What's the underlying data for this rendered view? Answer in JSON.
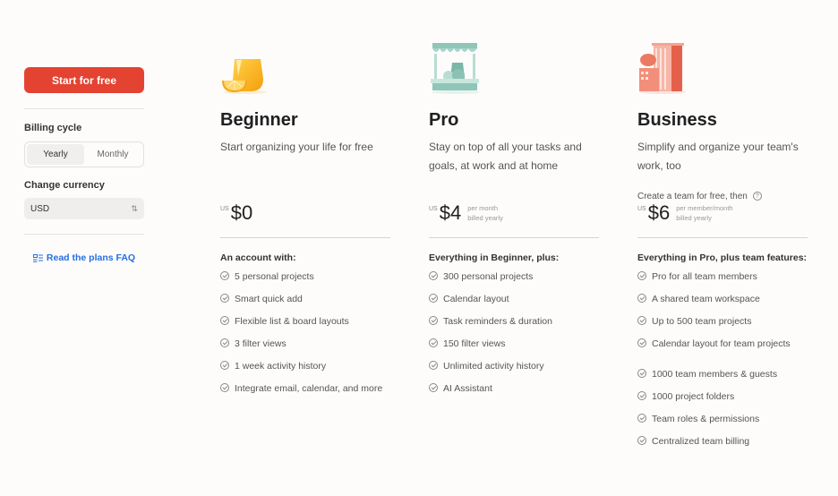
{
  "sidebar": {
    "cta_label": "Start for free",
    "billing_label": "Billing cycle",
    "billing_options": [
      "Yearly",
      "Monthly"
    ],
    "billing_selected": "Yearly",
    "currency_label": "Change currency",
    "currency_value": "USD",
    "faq_icon": "faq-list-icon",
    "faq_label": "Read the plans FAQ"
  },
  "plans": [
    {
      "name": "Beginner",
      "icon": "orange-juice-glass-icon",
      "description": "Start organizing your life for free",
      "currency_prefix": "US",
      "price": "$0",
      "price_note": [
        "",
        ""
      ],
      "features_heading": "An account with:",
      "features": [
        "5 personal projects",
        "Smart quick add",
        "Flexible list & board layouts",
        "3 filter views",
        "1 week activity history",
        "Integrate email, calendar, and more"
      ]
    },
    {
      "name": "Pro",
      "icon": "market-stall-icon",
      "description": "Stay on top of all your tasks and goals, at work and at home",
      "currency_prefix": "US",
      "price": "$4",
      "price_note": [
        "per month",
        "billed yearly"
      ],
      "features_heading": "Everything in Beginner, plus:",
      "features": [
        "300 personal projects",
        "Calendar layout",
        "Task reminders & duration",
        "150 filter views",
        "Unlimited activity history",
        "AI Assistant"
      ]
    },
    {
      "name": "Business",
      "icon": "office-building-icon",
      "description": "Simplify and organize your team's work, too",
      "team_note": "Create a team for free, then",
      "currency_prefix": "US",
      "price": "$6",
      "price_note": [
        "per member/month",
        "billed yearly"
      ],
      "features_heading": "Everything in Pro, plus team features:",
      "features": [
        "Pro for all team members",
        "A shared team workspace",
        "Up to 500 team projects",
        "Calendar layout for team projects"
      ],
      "features_extra": [
        "1000 team members & guests",
        "1000 project folders",
        "Team roles & permissions",
        "Centralized team billing"
      ]
    }
  ],
  "colors": {
    "primary": "#e44332",
    "link": "#246fe0",
    "background": "#fdfcfb"
  }
}
